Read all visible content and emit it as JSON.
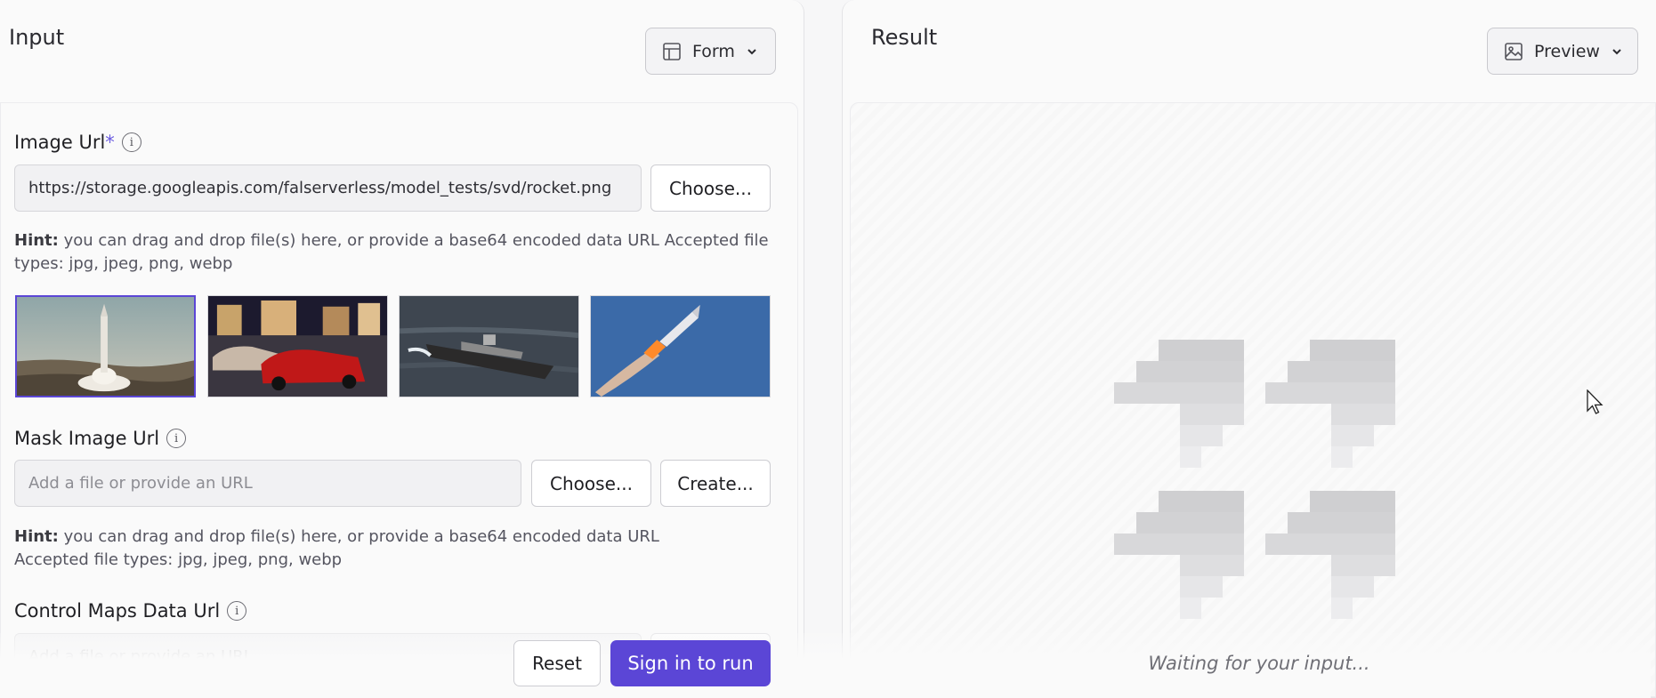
{
  "input_panel": {
    "title": "Input",
    "mode_button": {
      "label": "Form",
      "icon": "layout-icon"
    }
  },
  "result_panel": {
    "title": "Result",
    "mode_button": {
      "label": "Preview",
      "icon": "image-icon"
    },
    "waiting_text": "Waiting for your input..."
  },
  "image_url": {
    "label": "Image Url",
    "required_mark": "*",
    "value": "https://storage.googleapis.com/falserverless/model_tests/svd/rocket.png",
    "choose_label": "Choose...",
    "hint_bold": "Hint:",
    "hint_text": " you can drag and drop file(s) here, or provide a base64 encoded data URL Accepted file types: jpg, jpeg, png, webp",
    "examples": [
      "rocket-launch-desert",
      "red-mustang-cars",
      "ship-at-sea",
      "rocket-in-sky"
    ]
  },
  "mask_image_url": {
    "label": "Mask Image Url",
    "placeholder": "Add a file or provide an URL",
    "choose_label": "Choose...",
    "create_label": "Create...",
    "hint_bold": "Hint:",
    "hint_line1": " you can drag and drop file(s) here, or provide a base64 encoded data URL",
    "hint_line2": "Accepted file types: jpg, jpeg, png, webp"
  },
  "control_maps": {
    "label": "Control Maps Data Url",
    "placeholder": "Add a file or provide an URL"
  },
  "actions": {
    "reset_label": "Reset",
    "run_label": "Sign in to run"
  },
  "colors": {
    "accent": "#5b46d6",
    "required": "#6b5ce0"
  }
}
